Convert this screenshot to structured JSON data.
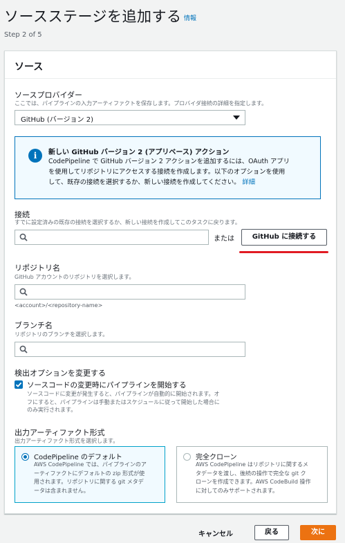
{
  "header": {
    "title": "ソースステージを追加する",
    "info_link": "情報",
    "step": "Step 2 of 5"
  },
  "panel": {
    "title": "ソース",
    "provider": {
      "label": "ソースプロバイダー",
      "description": "ここでは、パイプラインの入力アーティファクトを保存します。プロバイダ接続の詳細を指定します。",
      "selected": "GitHub (バージョン 2)"
    },
    "info_alert": {
      "title": "新しい GitHub バージョン 2 (アプリベース) アクション",
      "body_line1": "CodePipeline で GitHub バージョン 2 アクションを追加するには、OAuth アプリ",
      "body_line2": "を使用してリポジトリにアクセスする接続を作成します。以下のオプションを使用",
      "body_line3": "して、既存の接続を選択するか、新しい接続を作成してください。",
      "more_link": "詳細"
    },
    "connection": {
      "label": "接続",
      "description": "すでに設定済みの既存の接続を選択するか、新しい接続を作成してこのタスクに戻ります。",
      "value": "",
      "or_text": "または",
      "connect_button": "GitHub に接続する"
    },
    "repository": {
      "label": "リポジトリ名",
      "description": "GitHub アカウントのリポジトリを選択します。",
      "value": "",
      "hint": "<account>/<repository-name>"
    },
    "branch": {
      "label": "ブランチ名",
      "description": "リポジトリのブランチを選択します。",
      "value": ""
    },
    "detection": {
      "label": "検出オプションを変更する",
      "checkbox_label": "ソースコードの変更時にパイプラインを開始する",
      "checkbox_desc_line1": "ソースコードに変更が発生すると、パイプラインが自動的に開始されます。オ",
      "checkbox_desc_line2": "フにすると、パイプラインは手動またはスケジュールに従って開始した場合に",
      "checkbox_desc_line3": "のみ実行されます。",
      "checked": true
    },
    "artifact_format": {
      "label": "出力アーティファクト形式",
      "description": "出力アーティファクト形式を選択します。",
      "options": [
        {
          "title": "CodePipeline のデフォルト",
          "desc_line1": "AWS CodePipeline では、パイプラインのア",
          "desc_line2": "ーティファクトにデフォルトの zip 形式が使",
          "desc_line3": "用されます。リポジトリに関する git メタデ",
          "desc_line4": "ータは含まれません。",
          "selected": true
        },
        {
          "title": "完全クローン",
          "desc_line1": "AWS CodePipeline はリポジトリに関するメ",
          "desc_line2": "タデータを渡し、後続の操作で完全な git ク",
          "desc_line3": "ローンを作成できます。AWS CodeBuild 操作",
          "desc_line4": "に対してのみサポートされます。",
          "selected": false
        }
      ]
    }
  },
  "footer": {
    "cancel": "キャンセル",
    "back": "戻る",
    "next": "次に"
  },
  "colors": {
    "link": "#0073bb",
    "primary_button": "#ec7211",
    "highlight_underline": "#e11b22",
    "info_bg": "#f1faff"
  }
}
